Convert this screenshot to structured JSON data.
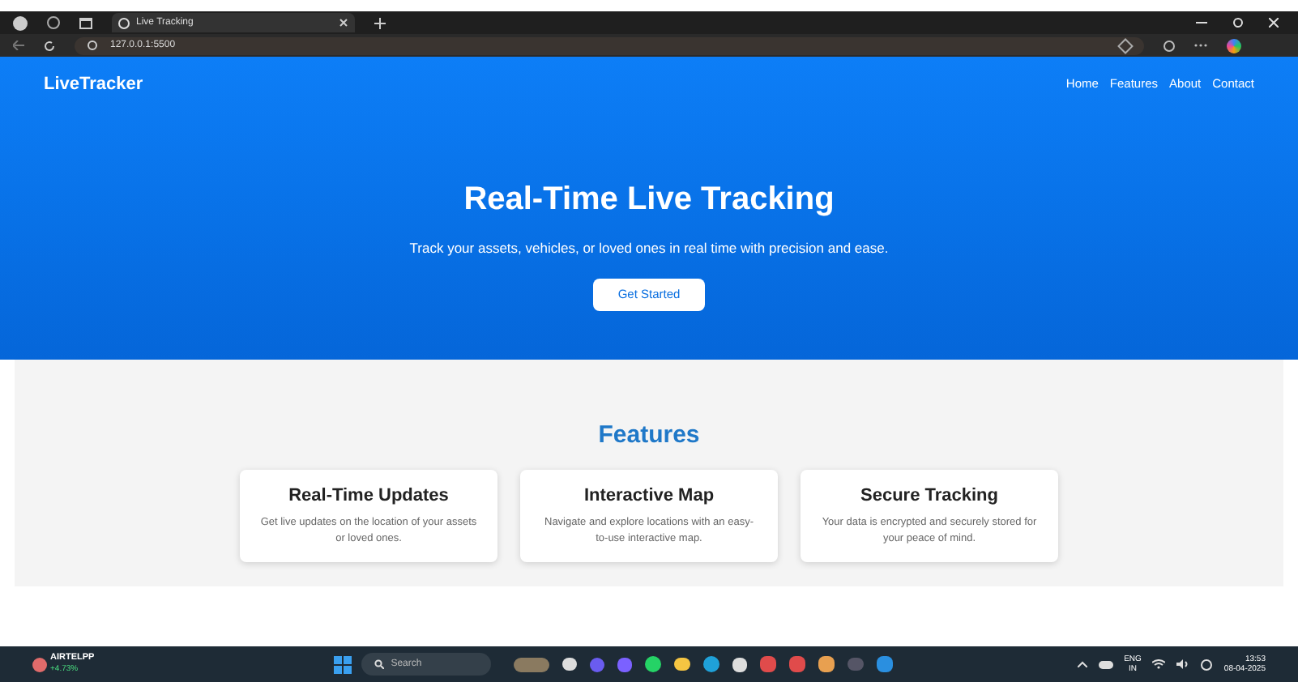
{
  "browser": {
    "tab_title": "Live Tracking",
    "address": "127.0.0.1:5500"
  },
  "header": {
    "brand": "LiveTracker",
    "nav": [
      "Home",
      "Features",
      "About",
      "Contact"
    ]
  },
  "hero": {
    "title": "Real-Time Live Tracking",
    "subtitle": "Track your assets, vehicles, or loved ones in real time with precision and ease.",
    "button": "Get Started"
  },
  "features": {
    "title": "Features",
    "cards": [
      {
        "title": "Real-Time Updates",
        "text": "Get live updates on the location of your assets or loved ones."
      },
      {
        "title": "Interactive Map",
        "text": "Navigate and explore locations with an easy-to-use interactive map."
      },
      {
        "title": "Secure Tracking",
        "text": "Your data is encrypted and securely stored for your peace of mind."
      }
    ]
  },
  "taskbar": {
    "stock_name": "AIRTELPP",
    "stock_change": "+4.73%",
    "search": "Search",
    "language": "ENG",
    "region": "IN",
    "time": "13:53",
    "date": "08-04-2025"
  }
}
